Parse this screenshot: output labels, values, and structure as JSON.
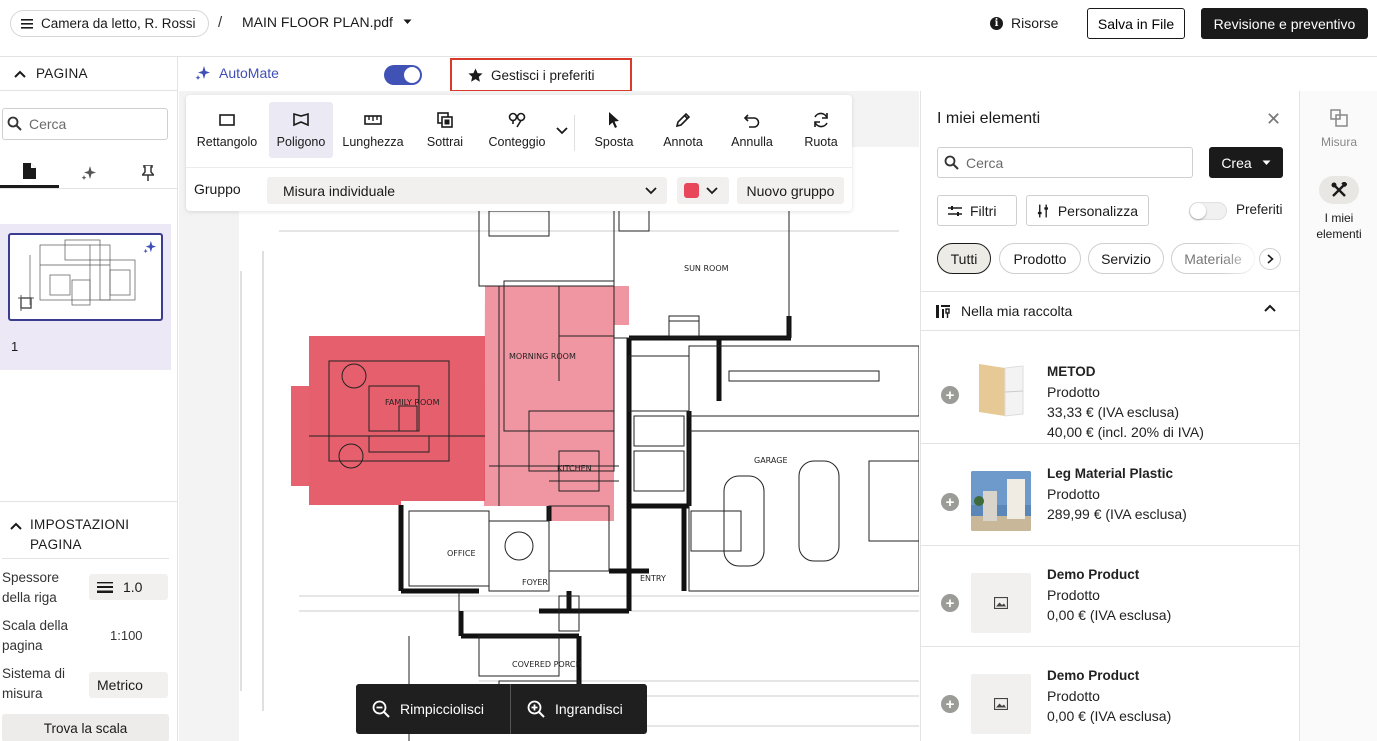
{
  "header": {
    "project": "Camera da letto, R. Rossi",
    "separator": "/",
    "file_name": "MAIN FLOOR PLAN.pdf",
    "resources": "Risorse",
    "save_file": "Salva in File",
    "review_quote": "Revisione e preventivo"
  },
  "left_panel": {
    "page_header": "PAGINA",
    "search_placeholder": "Cerca",
    "tabs": [
      "document-icon",
      "sparkle-icon",
      "pin-icon"
    ],
    "page_number": "1",
    "settings_title": "IMPOSTAZIONI PAGINA",
    "line_thickness_label": "Spessore della riga",
    "line_thickness_value": "1.0",
    "page_scale_label": "Scala della pagina",
    "page_scale_value": "1:100",
    "measure_system_label": "Sistema di misura",
    "measure_system_value": "Metrico",
    "find_scale": "Trova la scala"
  },
  "subbar": {
    "automate": "AutoMate",
    "automate_enabled": true,
    "favorites": "Gestisci i preferiti"
  },
  "toolbar": {
    "tools": [
      {
        "label": "Rettangolo",
        "icon": "rectangle-icon"
      },
      {
        "label": "Poligono",
        "icon": "polygon-icon"
      },
      {
        "label": "Lunghezza",
        "icon": "ruler-icon"
      },
      {
        "label": "Sottrai",
        "icon": "subtract-icon"
      },
      {
        "label": "Conteggio",
        "icon": "count-icon"
      },
      {
        "label": "Sposta",
        "icon": "cursor-icon"
      },
      {
        "label": "Annota",
        "icon": "pen-icon"
      },
      {
        "label": "Annulla",
        "icon": "undo-icon"
      },
      {
        "label": "Ruota",
        "icon": "rotate-icon"
      }
    ],
    "active_tool": "Poligono",
    "group_label": "Gruppo",
    "group_value": "Misura individuale",
    "group_color": "#e8475b",
    "new_group": "Nuovo gruppo"
  },
  "plan_labels": {
    "family_room": "FAMILY ROOM",
    "morning_room": "MORNING ROOM",
    "kitchen": "KITCHEN",
    "sun_room": "SUN ROOM",
    "garage": "GARAGE",
    "office": "OFFICE",
    "foyer": "FOYER",
    "entry": "ENTRY",
    "covered_porch": "COVERED PORCH"
  },
  "zoom": {
    "zoom_out": "Rimpicciolisci",
    "zoom_in": "Ingrandisci"
  },
  "right_panel": {
    "title": "I miei elementi",
    "search_placeholder": "Cerca",
    "create": "Crea",
    "filters": "Filtri",
    "customize": "Personalizza",
    "favorites_label": "Preferiti",
    "favorites_enabled": false,
    "categories": [
      "Tutti",
      "Prodotto",
      "Servizio",
      "Materiale"
    ],
    "active_category": "Tutti",
    "collection_header": "Nella mia raccolta",
    "items": [
      {
        "name": "METOD",
        "type": "Prodotto",
        "price1": "33,33 € (IVA esclusa)",
        "price2": "40,00 € (incl. 20% di IVA)",
        "image": "cabinet"
      },
      {
        "name": "Leg Material Plastic",
        "type": "Prodotto",
        "price1": "289,99 € (IVA esclusa)",
        "image": "room-photo"
      },
      {
        "name": "Demo Product",
        "type": "Prodotto",
        "price1": "0,00 € (IVA esclusa)",
        "image": "image-placeholder-icon"
      },
      {
        "name": "Demo Product",
        "type": "Prodotto",
        "price1": "0,00 € (IVA esclusa)",
        "image": "image-placeholder-icon"
      }
    ]
  },
  "rail": {
    "measure": "Misura",
    "my_items": "I miei elementi"
  }
}
